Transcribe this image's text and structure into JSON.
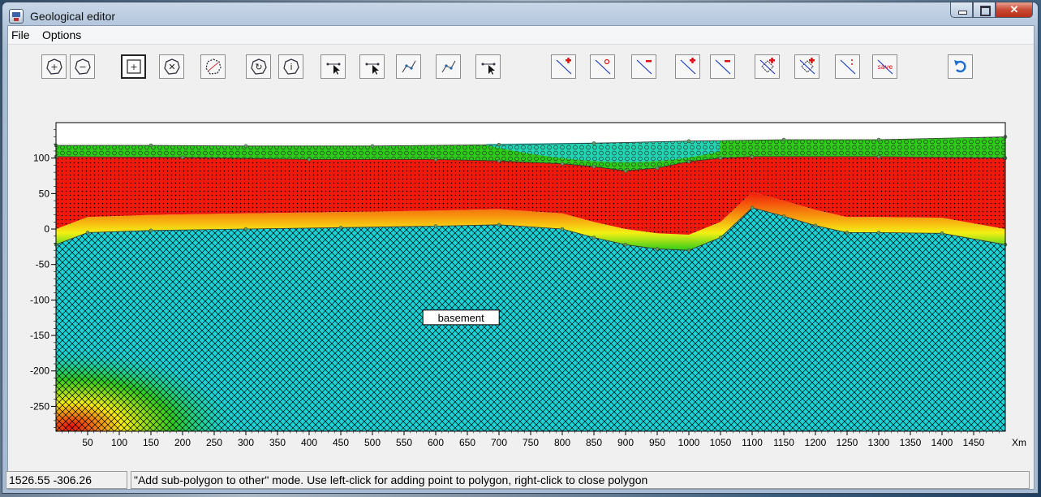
{
  "window": {
    "title": "Geological editor"
  },
  "menu": [
    {
      "label": "File"
    },
    {
      "label": "Options"
    }
  ],
  "toolbar": {
    "buttons": [
      {
        "icon": "add-point-circle-icon"
      },
      {
        "icon": "remove-point-circle-icon"
      },
      {
        "icon": "add-sub-polygon-icon"
      },
      {
        "icon": "split-polygon-icon"
      },
      {
        "icon": "polygon-dashed-icon"
      },
      {
        "icon": "rotate-polygon-icon"
      },
      {
        "icon": "info-polygon-icon"
      },
      {
        "icon": "add-node-arrow-icon"
      },
      {
        "icon": "remove-node-arrow-icon"
      },
      {
        "icon": "move-node-icon"
      },
      {
        "icon": "move-node-alt-icon"
      },
      {
        "icon": "select-arrow-icon"
      },
      {
        "icon": "line-add-icon"
      },
      {
        "icon": "line-point-icon"
      },
      {
        "icon": "line-remove-icon"
      },
      {
        "icon": "line-add-alt-icon"
      },
      {
        "icon": "line-remove-alt-icon"
      },
      {
        "icon": "polygon-add-icon"
      },
      {
        "icon": "polygon-add-alt-icon"
      },
      {
        "icon": "line-split-icon"
      },
      {
        "icon": "save-line-icon",
        "label": "save"
      },
      {
        "icon": "undo-icon"
      }
    ]
  },
  "plot": {
    "y_ticks": [
      100,
      50,
      0,
      -50,
      -100,
      -150,
      -200,
      -250
    ],
    "x_ticks": [
      50,
      100,
      150,
      200,
      250,
      300,
      350,
      400,
      450,
      500,
      550,
      600,
      650,
      700,
      750,
      800,
      850,
      900,
      950,
      1000,
      1050,
      1100,
      1150,
      1200,
      1250,
      1300,
      1350,
      1400,
      1450
    ],
    "x_unit": "Xm",
    "ylim": [
      -285,
      150
    ],
    "xlim": [
      0,
      1500
    ],
    "region_label": "basement",
    "colors": {
      "surface": "#2ecc1a",
      "red_layer": "#f11a0a",
      "basement": "#18d4d8",
      "yellow": "#f5f014"
    }
  },
  "status": {
    "coords": "1526.55 -306.26",
    "message": "\"Add sub-polygon to other\" mode. Use left-click for adding point to polygon, right-click to close polygon"
  }
}
